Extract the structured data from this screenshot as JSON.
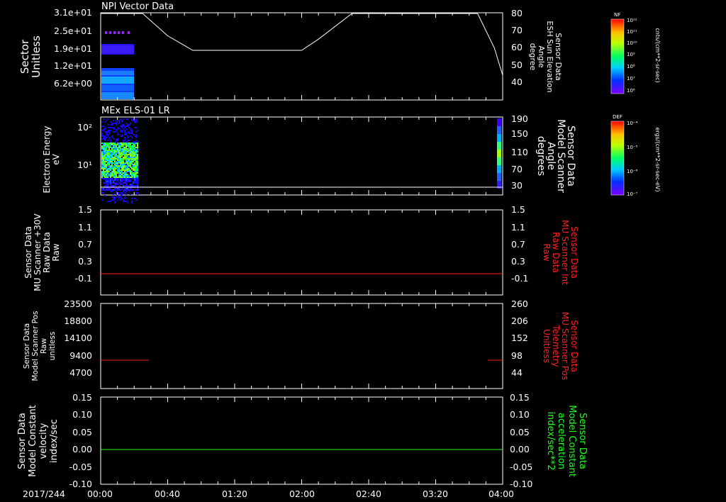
{
  "chart_data": [
    {
      "type": "heatmap",
      "title": "NPI Vector Data",
      "ylabel_left": [
        "Sector",
        "Unitless"
      ],
      "yticks_left": [
        "3.1e+01",
        "2.5e+01",
        "1.9e+01",
        "1.2e+01",
        "6.2e+00"
      ],
      "ylabel_right": [
        "Sensor Data",
        "ESH Sun Elevation",
        "Angle",
        "degree"
      ],
      "yticks_right": [
        "80",
        "70",
        "60",
        "50",
        "40"
      ],
      "ylim_right": [
        30,
        80
      ],
      "line_series": {
        "name": "Sensor Data ESH Sun Elevation Angle",
        "color": "#ffffff",
        "x": [
          "00:00",
          "00:25",
          "00:40",
          "00:55",
          "02:00",
          "02:10",
          "02:30",
          "03:45",
          "03:55",
          "04:00"
        ],
        "y": [
          80,
          80,
          67,
          58.5,
          58.5,
          65,
          80,
          80,
          60,
          44
        ]
      },
      "colorbar": {
        "label": "NF",
        "units": "cnts/(cm**2-sr-sec)",
        "ticks": [
          "10¹²",
          "10¹¹",
          "10¹⁰",
          "10⁹",
          "10⁸",
          "10⁷",
          "10⁶"
        ]
      }
    },
    {
      "type": "heatmap",
      "title": "MEx ELS-01 LR",
      "ylabel_left": [
        "Electron Energy",
        "eV"
      ],
      "yticks_left": [
        "10²",
        "10¹"
      ],
      "ylabel_right": [
        "Sensor Data",
        "Model Scanner",
        "Angle",
        "degrees"
      ],
      "yticks_right": [
        "190",
        "150",
        "110",
        "70",
        "30"
      ],
      "colorbar": {
        "label": "DEF",
        "units": "ergs/(cm**2-sr-sec-eV)",
        "ticks": [
          "10⁻⁴",
          "10⁻⁵",
          "10⁻⁶",
          "10⁻⁷"
        ]
      }
    },
    {
      "type": "line",
      "ylabel_left": [
        "Sensor Data",
        "MU Scanner +30V",
        "Raw Data",
        "Raw"
      ],
      "yticks_left": [
        "1.5",
        "1.1",
        "0.7",
        "0.3",
        "-0.1"
      ],
      "ylabel_right": [
        "Sensor Data",
        "MU Scanner Int",
        "Raw Data",
        "Raw"
      ],
      "yticks_right": [
        "1.5",
        "1.1",
        "0.7",
        "0.3",
        "-0.1"
      ],
      "ylim": [
        -0.35,
        1.5
      ],
      "series": [
        {
          "color": "#ff2020",
          "x": [
            "00:00",
            "04:00"
          ],
          "y": [
            0.0,
            0.0
          ]
        }
      ]
    },
    {
      "type": "line",
      "ylabel_left": [
        "Sensor Data",
        "Model Scanner Pos",
        "Raw",
        "unitless"
      ],
      "yticks_left": [
        "23500",
        "18800",
        "14100",
        "9400",
        "4700"
      ],
      "ylabel_right": [
        "Sensor Data",
        "MU Scanner Pos",
        "Telemetry",
        "Unitless"
      ],
      "yticks_right": [
        "260",
        "206",
        "152",
        "98",
        "44"
      ],
      "ylim": [
        0,
        23500
      ],
      "series": [
        {
          "color": "#ff2020",
          "x": [
            "00:00",
            "00:43"
          ],
          "y": [
            8100,
            8100
          ]
        },
        {
          "color": "#ff2020",
          "x": [
            "03:55",
            "04:00"
          ],
          "y": [
            8100,
            8100
          ]
        }
      ]
    },
    {
      "type": "line",
      "ylabel_left": [
        "Sensor Data",
        "Model Constant",
        "velocity",
        "index/sec"
      ],
      "yticks_left": [
        "0.15",
        "0.10",
        "0.05",
        "0.00",
        "-0.05",
        "-0.10"
      ],
      "ylabel_right": [
        "Sensor Data",
        "Model Constant",
        "acceleration",
        "index/sec**2"
      ],
      "yticks_right": [
        "0.15",
        "0.10",
        "0.05",
        "0.00",
        "-0.05",
        "-0.10"
      ],
      "ylim": [
        -0.1,
        0.15
      ],
      "series": [
        {
          "color": "#20ff20",
          "x": [
            "00:00",
            "04:00"
          ],
          "y": [
            0.0,
            0.0
          ]
        }
      ]
    }
  ],
  "x_axis": {
    "date_label": "2017/244",
    "ticks": [
      "00:00",
      "00:40",
      "01:20",
      "02:00",
      "02:40",
      "03:20",
      "04:00"
    ],
    "xlim": [
      "00:00",
      "04:00"
    ]
  },
  "colors": {
    "background": "#000000",
    "axes": "#ffffff",
    "red": "#ff2020",
    "green": "#20ff20"
  }
}
